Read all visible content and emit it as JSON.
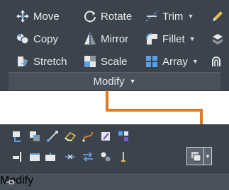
{
  "top_panel": {
    "tools": [
      {
        "label": "Move",
        "icon": "move-icon"
      },
      {
        "label": "Rotate",
        "icon": "rotate-icon"
      },
      {
        "label": "Trim",
        "icon": "trim-icon",
        "has_dropdown": true
      },
      {
        "label": "Copy",
        "icon": "copy-icon"
      },
      {
        "label": "Mirror",
        "icon": "mirror-icon"
      },
      {
        "label": "Fillet",
        "icon": "fillet-icon",
        "has_dropdown": true
      },
      {
        "label": "Stretch",
        "icon": "stretch-icon"
      },
      {
        "label": "Scale",
        "icon": "scale-icon"
      },
      {
        "label": "Array",
        "icon": "array-icon",
        "has_dropdown": true
      }
    ],
    "footer_label": "Modify"
  },
  "bottom_panel": {
    "footer_label": "Modify"
  },
  "colors": {
    "panel_bg": "#3b434d",
    "footer_bg": "#48515c",
    "connector_orange": "#e07a1f",
    "text": "#ececec"
  }
}
